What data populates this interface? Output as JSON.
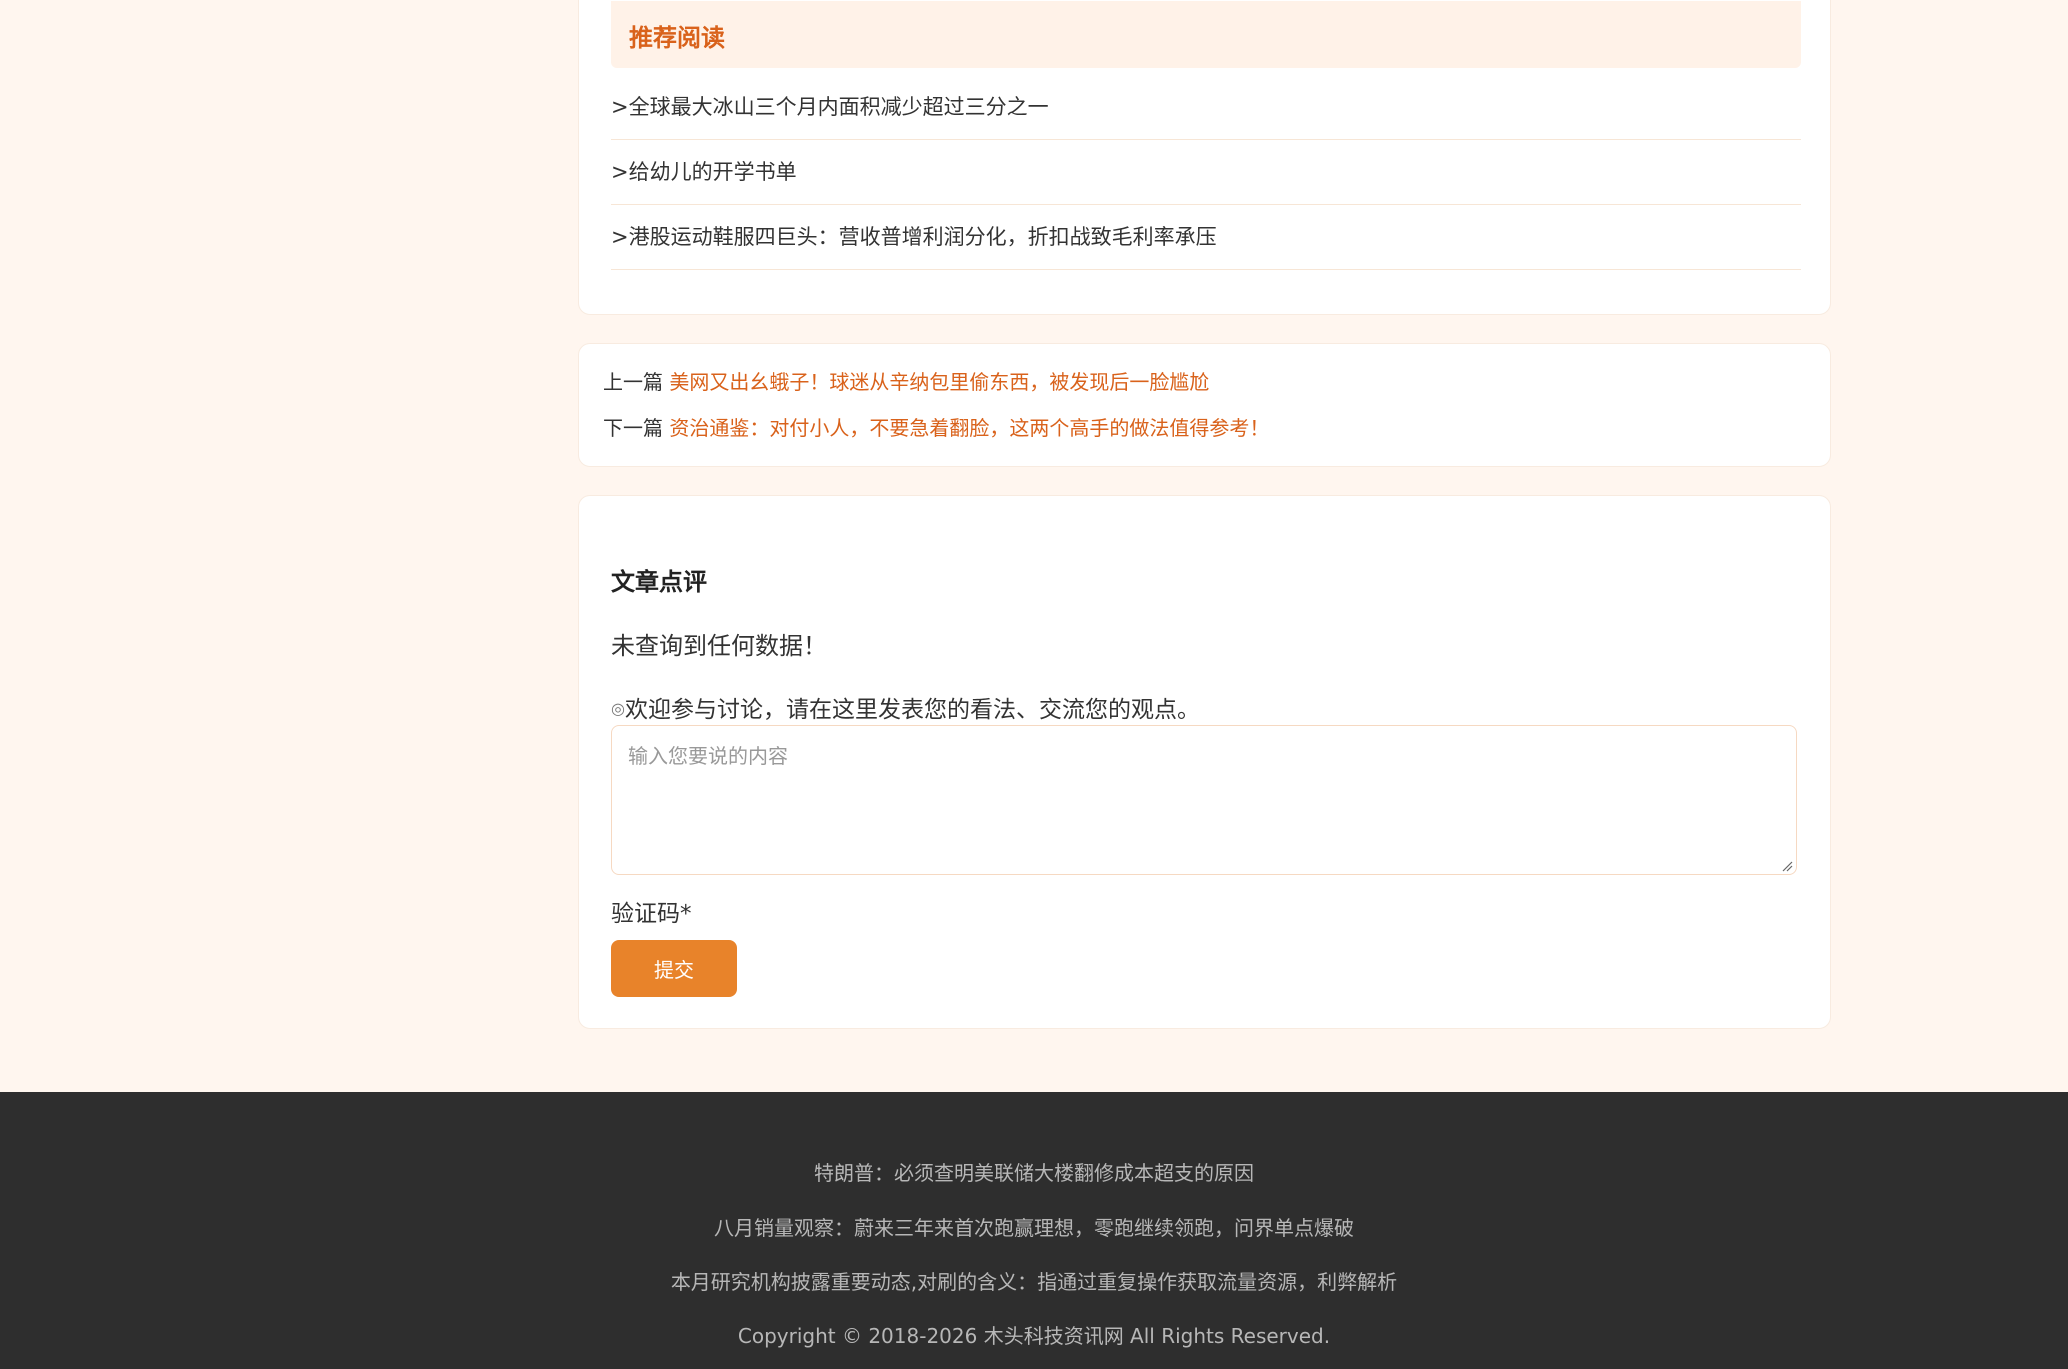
{
  "recommend": {
    "title": "推荐阅读",
    "items": [
      {
        "label": ">全球最大冰山三个月内面积减少超过三分之一"
      },
      {
        "label": ">给幼儿的开学书单"
      },
      {
        "label": ">港股运动鞋服四巨头：营收普增利润分化，折扣战致毛利率承压"
      }
    ]
  },
  "nav": {
    "prev_label": "上一篇",
    "prev_title": "美网又出幺蛾子！球迷从辛纳包里偷东西，被发现后一脸尴尬",
    "next_label": "下一篇",
    "next_title": "资治通鉴：对付小人，不要急着翻脸，这两个高手的做法值得参考！"
  },
  "comment": {
    "title": "文章点评",
    "empty_text": "未查询到任何数据！",
    "hint_dot": "◎",
    "hint_text": "欢迎参与讨论，请在这里发表您的看法、交流您的观点。",
    "placeholder": "输入您要说的内容",
    "captcha_label": "验证码*",
    "submit_label": "提交"
  },
  "footer": {
    "links": [
      "特朗普：必须查明美联储大楼翻修成本超支的原因",
      "八月销量观察：蔚来三年来首次跑赢理想，零跑继续领跑，问界单点爆破",
      "本月研究机构披露重要动态,对刷的含义：指通过重复操作获取流量资源，利弊解析"
    ],
    "copyright": "Copyright © 2018-2026 木头科技资讯网 All Rights Reserved."
  },
  "colors": {
    "page_bg": "#fff6ef",
    "accent": "#d9621b",
    "button": "#e8832a",
    "footer_bg": "#2e2e2e"
  }
}
